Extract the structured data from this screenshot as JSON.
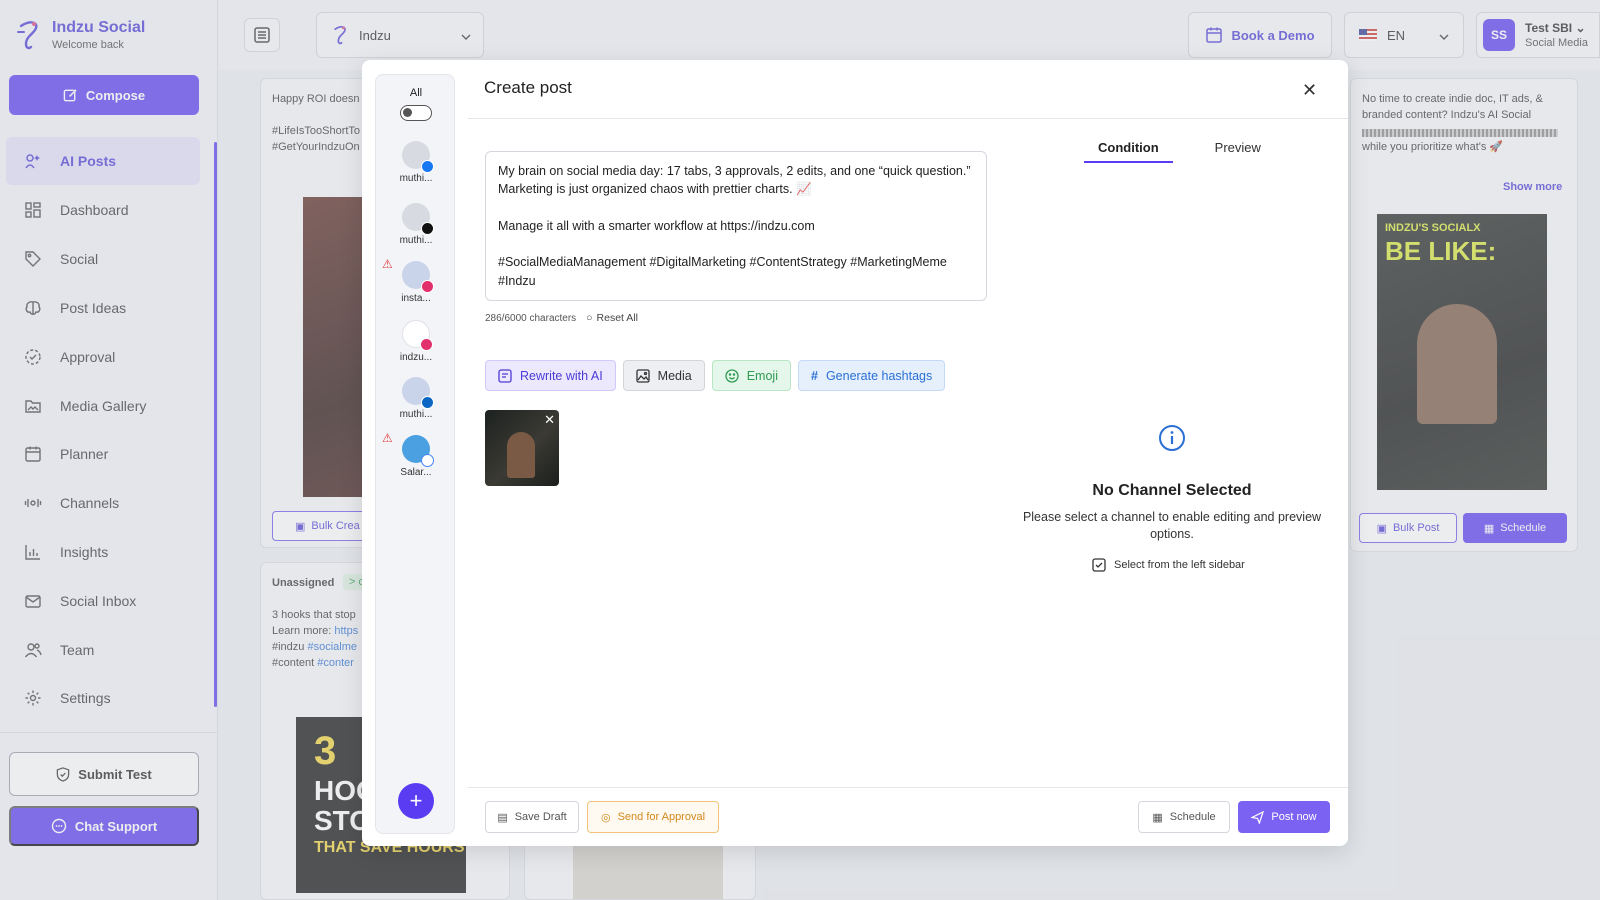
{
  "brand": {
    "name": "Indzu Social",
    "subtitle": "Welcome back"
  },
  "sidebar": {
    "compose_label": "Compose",
    "items": [
      {
        "label": "AI Posts",
        "icon": "ai-posts-icon",
        "active": true
      },
      {
        "label": "Dashboard",
        "icon": "dashboard-icon"
      },
      {
        "label": "Social",
        "icon": "tag-icon"
      },
      {
        "label": "Post Ideas",
        "icon": "brain-icon"
      },
      {
        "label": "Approval",
        "icon": "approval-icon"
      },
      {
        "label": "Media Gallery",
        "icon": "folder-image-icon"
      },
      {
        "label": "Planner",
        "icon": "calendar-icon"
      },
      {
        "label": "Channels",
        "icon": "channels-icon"
      },
      {
        "label": "Insights",
        "icon": "bar-chart-icon"
      },
      {
        "label": "Social Inbox",
        "icon": "inbox-icon"
      },
      {
        "label": "Team",
        "icon": "team-icon"
      },
      {
        "label": "Settings",
        "icon": "gear-icon"
      }
    ],
    "submit_test_label": "Submit Test",
    "chat_support_label": "Chat Support"
  },
  "header": {
    "workspace": "Indzu",
    "book_demo": "Book a Demo",
    "language": "EN",
    "user_initials": "SS",
    "user_name": "Test SBI",
    "user_org": "Social Media"
  },
  "background": {
    "card1_text1": "Happy ROI doesn",
    "card1_text2": "#LifeIsTooShortTo",
    "card1_text3": "#GetYourIndzuOn",
    "card1_bulk": "Bulk Crea",
    "card2_unassigned": "Unassigned",
    "card2_badge": "> c",
    "card2_text1": "3 hooks that stop",
    "card2_text2": "Learn more:",
    "card2_link": "https",
    "card2_text3": "#indzu",
    "card2_text3_link": "#socialme",
    "card2_text4": "#content",
    "card2_text4_link": "#conter",
    "card2_poster_big": "3",
    "card2_poster_line1": "HOOK",
    "card2_poster_line2": "STOP",
    "card2_poster_line3": "THAT SAVE HOURS",
    "right_text": "No time to create indie doc, IT ads, & branded content? Indzu's AI Social",
    "right_text2": "while you prioritize what's 🚀",
    "right_show_more": "Show more",
    "right_poster_title": "INDZU'S SOCIALX",
    "right_poster_big": "BE LIKE:",
    "right_bulk": "Bulk Post",
    "right_schedule": "Schedule"
  },
  "modal": {
    "title": "Create post",
    "all_label": "All",
    "channels": [
      {
        "label": "muthi...",
        "badge": "facebook-icon",
        "warning": false
      },
      {
        "label": "muthi...",
        "badge": "tiktok-icon",
        "warning": false
      },
      {
        "label": "insta...",
        "badge": "instagram-icon",
        "warning": true
      },
      {
        "label": "indzu...",
        "badge": "instagram-icon",
        "warning": false
      },
      {
        "label": "muthi...",
        "badge": "linkedin-icon",
        "warning": false
      },
      {
        "label": "Salar...",
        "badge": "google-icon",
        "warning": true
      }
    ],
    "post_text": "My brain on social media day: 17 tabs, 3 approvals, 2 edits, and one “quick question.” Marketing is just organized chaos with prettier charts. 📈\n\nManage it all with a smarter workflow at https://indzu.com\n\n#SocialMediaManagement #DigitalMarketing #ContentStrategy #MarketingMeme #Indzu",
    "char_count": "286/6000 characters",
    "reset_all": "Reset All",
    "tools": {
      "rewrite": "Rewrite with AI",
      "media": "Media",
      "emoji": "Emoji",
      "hashtags": "Generate hashtags"
    },
    "tabs": {
      "condition": "Condition",
      "preview": "Preview"
    },
    "no_channel_title": "No Channel Selected",
    "no_channel_desc": "Please select a channel to enable editing and preview options.",
    "select_hint": "Select from the left sidebar",
    "footer": {
      "save_draft": "Save Draft",
      "send_approval": "Send for Approval",
      "schedule": "Schedule",
      "post_now": "Post now"
    }
  },
  "colors": {
    "accent": "#5a3df2",
    "warning": "#e03b3b",
    "emoji_green": "#2f9a52",
    "hashtag_blue": "#2a6fd4",
    "approval_orange": "#d4881d"
  }
}
